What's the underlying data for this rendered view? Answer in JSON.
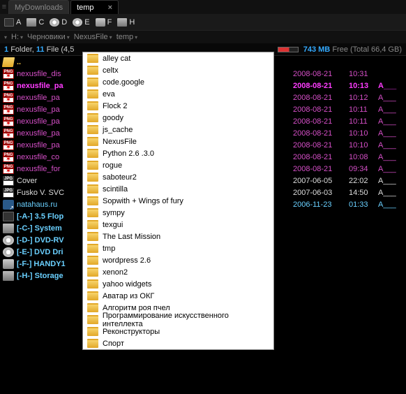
{
  "tabs": [
    {
      "label": "MyDownloads",
      "active": false
    },
    {
      "label": "temp",
      "active": true
    }
  ],
  "drives": [
    {
      "letter": "A",
      "kind": "floppy"
    },
    {
      "letter": "C",
      "kind": "hdd"
    },
    {
      "letter": "D",
      "kind": "dvd"
    },
    {
      "letter": "E",
      "kind": "dvd"
    },
    {
      "letter": "F",
      "kind": "usb"
    },
    {
      "letter": "H",
      "kind": "hdd"
    }
  ],
  "breadcrumb": {
    "segments": [
      "H:",
      "Черновики",
      "NexusFile",
      "temp"
    ]
  },
  "status": {
    "folders": "1",
    "folders_label": "Folder,",
    "files": "11",
    "files_label": "File",
    "size_partial": "(4,5",
    "free_value": "743 MB",
    "free_label": "Free",
    "total_label": "(Total",
    "total_value": "66,4 GB)"
  },
  "rows": [
    {
      "cls": "up",
      "icon": "folder-open",
      "name": "..",
      "date": "",
      "time": "",
      "attr": ""
    },
    {
      "cls": "png",
      "icon": "png",
      "name": "nexusfile_dis",
      "date": "2008-08-21",
      "time": "10:31",
      "attr": ""
    },
    {
      "cls": "sel",
      "icon": "png",
      "name": "nexusfile_pa",
      "date": "2008-08-21",
      "time": "10:13",
      "attr": "A___"
    },
    {
      "cls": "png",
      "icon": "png",
      "name": "nexusfile_pa",
      "date": "2008-08-21",
      "time": "10:12",
      "attr": "A___"
    },
    {
      "cls": "png",
      "icon": "png",
      "name": "nexusfile_pa",
      "date": "2008-08-21",
      "time": "10:11",
      "attr": "A___"
    },
    {
      "cls": "png",
      "icon": "png",
      "name": "nexusfile_pa",
      "date": "2008-08-21",
      "time": "10:11",
      "attr": "A___"
    },
    {
      "cls": "png",
      "icon": "png",
      "name": "nexusfile_pa",
      "date": "2008-08-21",
      "time": "10:10",
      "attr": "A___"
    },
    {
      "cls": "png",
      "icon": "png",
      "name": "nexusfile_pa",
      "date": "2008-08-21",
      "time": "10:10",
      "attr": "A___"
    },
    {
      "cls": "png",
      "icon": "png",
      "name": "nexusfile_co",
      "date": "2008-08-21",
      "time": "10:08",
      "attr": "A___"
    },
    {
      "cls": "png",
      "icon": "png",
      "name": "nexusfile_for",
      "date": "2008-08-21",
      "time": "09:34",
      "attr": "A___"
    },
    {
      "cls": "jpg",
      "icon": "jpg",
      "name": "Cover",
      "date": "2007-06-05",
      "time": "22:02",
      "attr": "A___"
    },
    {
      "cls": "jpg",
      "icon": "jpg",
      "name": "Fusko V. SVC",
      "date": "2007-06-03",
      "time": "14:50",
      "attr": "A___"
    },
    {
      "cls": "lnk",
      "icon": "link",
      "name": "natahaus.ru",
      "date": "2006-11-23",
      "time": "01:33",
      "attr": "A___"
    },
    {
      "cls": "drv",
      "icon": "floppy",
      "name": "[-A-] 3.5 Flop",
      "date": "",
      "time": "",
      "attr": ""
    },
    {
      "cls": "drv",
      "icon": "hdd",
      "name": "[-C-] System",
      "date": "",
      "time": "",
      "attr": ""
    },
    {
      "cls": "drv",
      "icon": "dvd",
      "name": "[-D-] DVD-RV",
      "date": "",
      "time": "",
      "attr": ""
    },
    {
      "cls": "drv",
      "icon": "dvd",
      "name": "[-E-] DVD Dri",
      "date": "",
      "time": "",
      "attr": ""
    },
    {
      "cls": "drv",
      "icon": "usb",
      "name": "[-F-] HANDY1",
      "date": "",
      "time": "",
      "attr": ""
    },
    {
      "cls": "drv",
      "icon": "hdd",
      "name": "[-H-] Storage",
      "date": "",
      "time": "",
      "attr": ""
    }
  ],
  "dropdown": [
    "alley cat",
    "celtx",
    "code.google",
    "eva",
    "Flock 2",
    "goody",
    "js_cache",
    "NexusFile",
    "Python 2.6 .3.0",
    "rogue",
    "saboteur2",
    "scintilla",
    "Sopwith + Wings of fury",
    "sympy",
    "texgui",
    "The Last Mission",
    "tmp",
    "wordpress 2.6",
    "xenon2",
    "yahoo widgets",
    "Аватар из ОКГ",
    "Алгоритм роя пчел",
    "Программирование искусственного интеллекта",
    "Реконструкторы",
    "Спорт"
  ]
}
